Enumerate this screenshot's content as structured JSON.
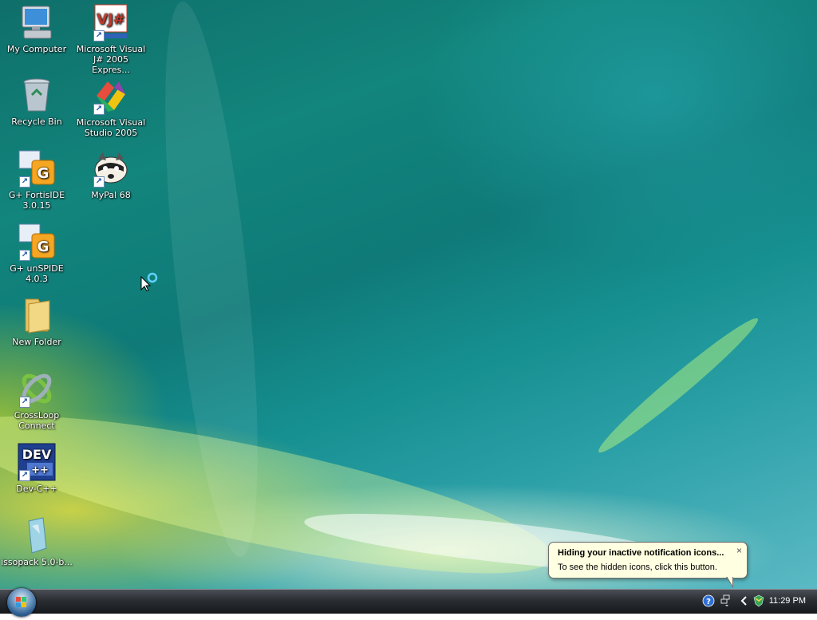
{
  "desktop": {
    "icons": [
      {
        "label": "My Computer",
        "icon": "computer-icon",
        "shortcut": false
      },
      {
        "label": "Recycle Bin",
        "icon": "recycle-bin-icon",
        "shortcut": false
      },
      {
        "label": "G+ FortisIDE 3.0.15",
        "icon": "fortiside-icon",
        "shortcut": true
      },
      {
        "label": "G+ unSPIDE 4.0.3",
        "icon": "unspide-icon",
        "shortcut": true
      },
      {
        "label": "New Folder",
        "icon": "folder-icon",
        "shortcut": false
      },
      {
        "label": "CrossLoop Connect",
        "icon": "crossloop-icon",
        "shortcut": true
      },
      {
        "label": "Dev-C++",
        "icon": "devcpp-icon",
        "shortcut": true
      },
      {
        "label": "issopack 5.0-b...",
        "icon": "issopack-icon",
        "shortcut": false
      },
      {
        "label": "Microsoft Visual J# 2005 Expres...",
        "icon": "vjsharp-icon",
        "shortcut": true
      },
      {
        "label": "Microsoft Visual Studio 2005",
        "icon": "visual-studio-icon",
        "shortcut": true
      },
      {
        "label": "MyPal 68",
        "icon": "mypal-icon",
        "shortcut": true
      }
    ]
  },
  "notification": {
    "title": "Hiding your inactive notification icons...",
    "text": "To see the hidden icons, click this button.",
    "close": "×"
  },
  "taskbar": {
    "clock": "11:29 PM",
    "tray_icons": [
      "help-icon",
      "network-icon",
      "show-hidden-icons-chevron",
      "security-icon"
    ]
  },
  "colors": {
    "balloon_bg": "#ffffe1",
    "taskbar_top": "#4a4f55",
    "desktop_teal": "#12857c"
  }
}
